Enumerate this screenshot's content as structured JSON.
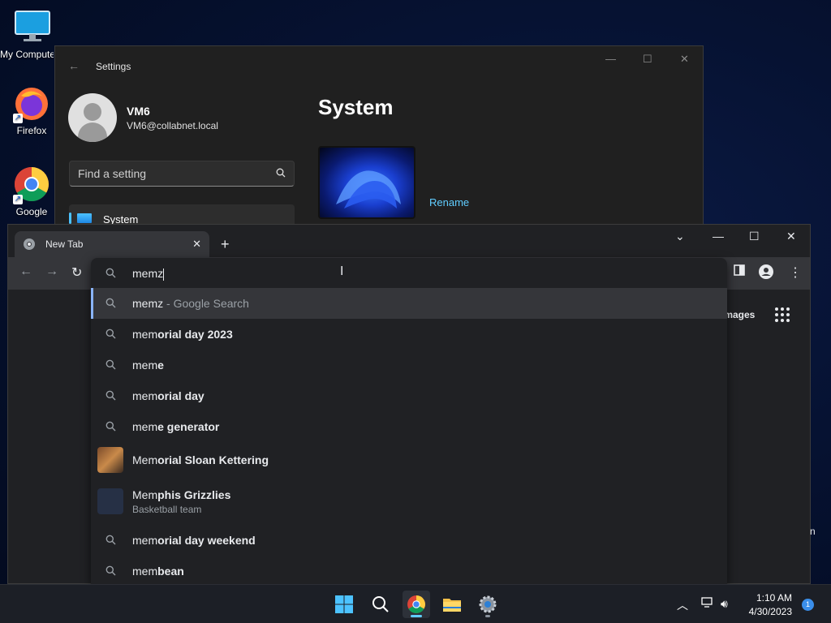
{
  "desktop": {
    "icons": [
      {
        "label": "My Computer"
      },
      {
        "label": "Firefox"
      },
      {
        "label": "Google Chrome"
      }
    ]
  },
  "settings": {
    "title": "Settings",
    "user_name": "VM6",
    "user_email": "VM6@collabnet.local",
    "search_placeholder": "Find a setting",
    "nav_selected": "System",
    "heading": "System",
    "rename_link": "Rename"
  },
  "chrome": {
    "tab_title": "New Tab",
    "omnibox_query": "memz",
    "ntp_images_link": "Images",
    "suggestions": [
      {
        "typed": "memz",
        "completion": "",
        "suffix": " - Google Search",
        "kind": "search",
        "selected": true
      },
      {
        "typed": "mem",
        "completion": "orial day 2023",
        "kind": "search"
      },
      {
        "typed": "mem",
        "completion": "e",
        "kind": "search"
      },
      {
        "typed": "mem",
        "completion": "orial day",
        "kind": "search"
      },
      {
        "typed": "mem",
        "completion": "e generator",
        "kind": "search"
      },
      {
        "typed": "Mem",
        "completion": "orial Sloan Kettering",
        "kind": "entity"
      },
      {
        "typed": "Mem",
        "completion": "phis Grizzlies",
        "subtitle": "Basketball team",
        "kind": "entity"
      },
      {
        "typed": "mem",
        "completion": "orial day weekend",
        "kind": "search"
      },
      {
        "typed": "mem",
        "completion": "bean",
        "kind": "search"
      }
    ]
  },
  "taskbar": {
    "time": "1:10 AM",
    "date": "4/30/2023",
    "notification_count": "1",
    "apps": [
      "start-icon",
      "search-icon",
      "chrome-icon",
      "file-explorer-icon",
      "settings-icon"
    ]
  },
  "colors": {
    "accent": "#60cdff",
    "chrome_toolbar": "#35363a",
    "chrome_bg": "#202124",
    "settings_bg": "#202020"
  }
}
